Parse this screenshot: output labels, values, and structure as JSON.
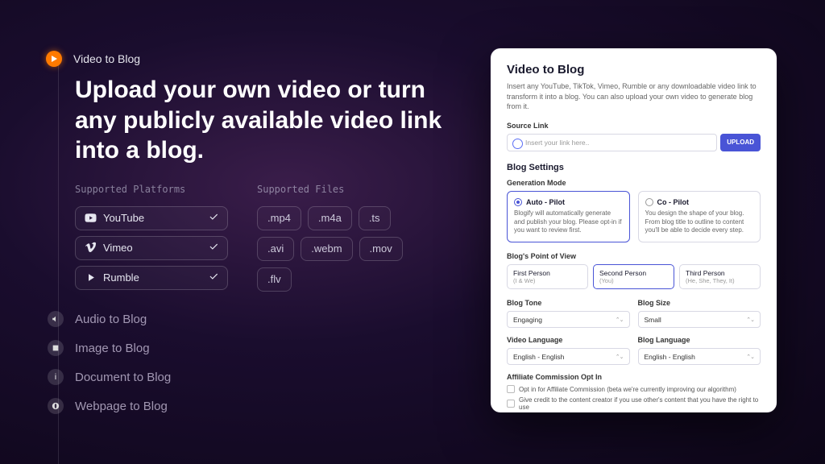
{
  "left": {
    "crumb": "Video to Blog",
    "headline": "Upload your own video or turn any publicly available video link into a blog.",
    "platforms_label": "Supported Platforms",
    "platforms": [
      "YouTube",
      "Vimeo",
      "Rumble"
    ],
    "files_label": "Supported Files",
    "files": [
      ".mp4",
      ".m4a",
      ".ts",
      ".avi",
      ".webm",
      ".mov",
      ".flv"
    ],
    "others": [
      "Audio to Blog",
      "Image to Blog",
      "Document to Blog",
      "Webpage to Blog"
    ]
  },
  "panel": {
    "title": "Video to Blog",
    "desc": "Insert any YouTube, TikTok, Vimeo, Rumble or any downloadable video link to transform it into a blog. You can also upload your own video to generate blog from it.",
    "source_label": "Source Link",
    "source_placeholder": "Insert your link here..",
    "upload_btn": "UPLOAD",
    "settings_label": "Blog Settings",
    "gen_mode_label": "Generation Mode",
    "modes": [
      {
        "title": "Auto - Pilot",
        "desc": "Blogify will automatically generate and publish your blog. Please opt-in if you want to review first."
      },
      {
        "title": "Co - Pilot",
        "desc": "You design the shape of your blog. From blog title to outline to content you'll be able to decide every step."
      }
    ],
    "pov_label": "Blog's Point of View",
    "pov": [
      {
        "t": "First Person",
        "s": "(I & We)"
      },
      {
        "t": "Second Person",
        "s": "(You)"
      },
      {
        "t": "Third Person",
        "s": "(He, She, They, It)"
      }
    ],
    "tone_label": "Blog Tone",
    "tone_value": "Engaging",
    "size_label": "Blog Size",
    "size_value": "Small",
    "vlang_label": "Video Language",
    "vlang_value": "English - English",
    "blang_label": "Blog Language",
    "blang_value": "English - English",
    "aff_label": "Affiliate Commission Opt In",
    "aff_1": "Opt in for Affiliate Commission (beta we're currently improving our algorithm)",
    "aff_2": "Give credit to the content creator if you use other's content that you have the right to use"
  }
}
